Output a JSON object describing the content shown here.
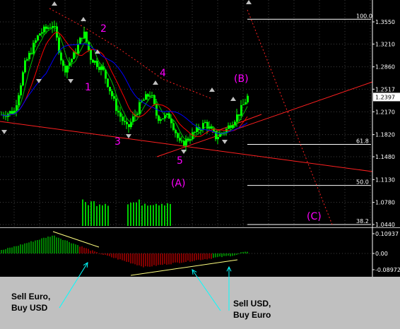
{
  "chart_data": [
    {
      "type": "candlestick",
      "y_ticks": [
        "1.3550",
        "1.3210",
        "1.2860",
        "1.2517",
        "1.2170",
        "1.1820",
        "1.1480",
        "1.1130",
        "1.0780",
        "1.0440"
      ],
      "current_price": "1.2397",
      "grid": true,
      "colors": {
        "background": "#000000",
        "candles": "#00ff00",
        "axis": "#ffffff",
        "grid": "#404040",
        "ma_fast": "#00c000",
        "ma_mid": "#ff0000",
        "ma_slow": "#0000ff",
        "trendline": "#ff2020",
        "volume": "#00ff00",
        "wave_labels": "#ff00ff"
      },
      "fib_levels": [
        {
          "label": "100.0",
          "value": 1.359
        },
        {
          "label": "61.8",
          "value": 1.167
        },
        {
          "label": "50.0",
          "value": 1.104
        },
        {
          "label": "38.2",
          "value": 1.044
        }
      ],
      "wave_labels": [
        "1",
        "2",
        "3",
        "4",
        "5",
        "(A)",
        "(B)",
        "(C)"
      ]
    },
    {
      "type": "histogram",
      "y_ticks": [
        "0.10937",
        "0.00",
        "-0.08972"
      ],
      "colors": {
        "positive": "#00ff00",
        "negative": "#ff0000",
        "trendline": "#ffff80"
      }
    }
  ],
  "annotations": {
    "sell_euro": "Sell Euro,\nBuy USD",
    "sell_usd": "Sell USD,\nBuy Euro"
  }
}
